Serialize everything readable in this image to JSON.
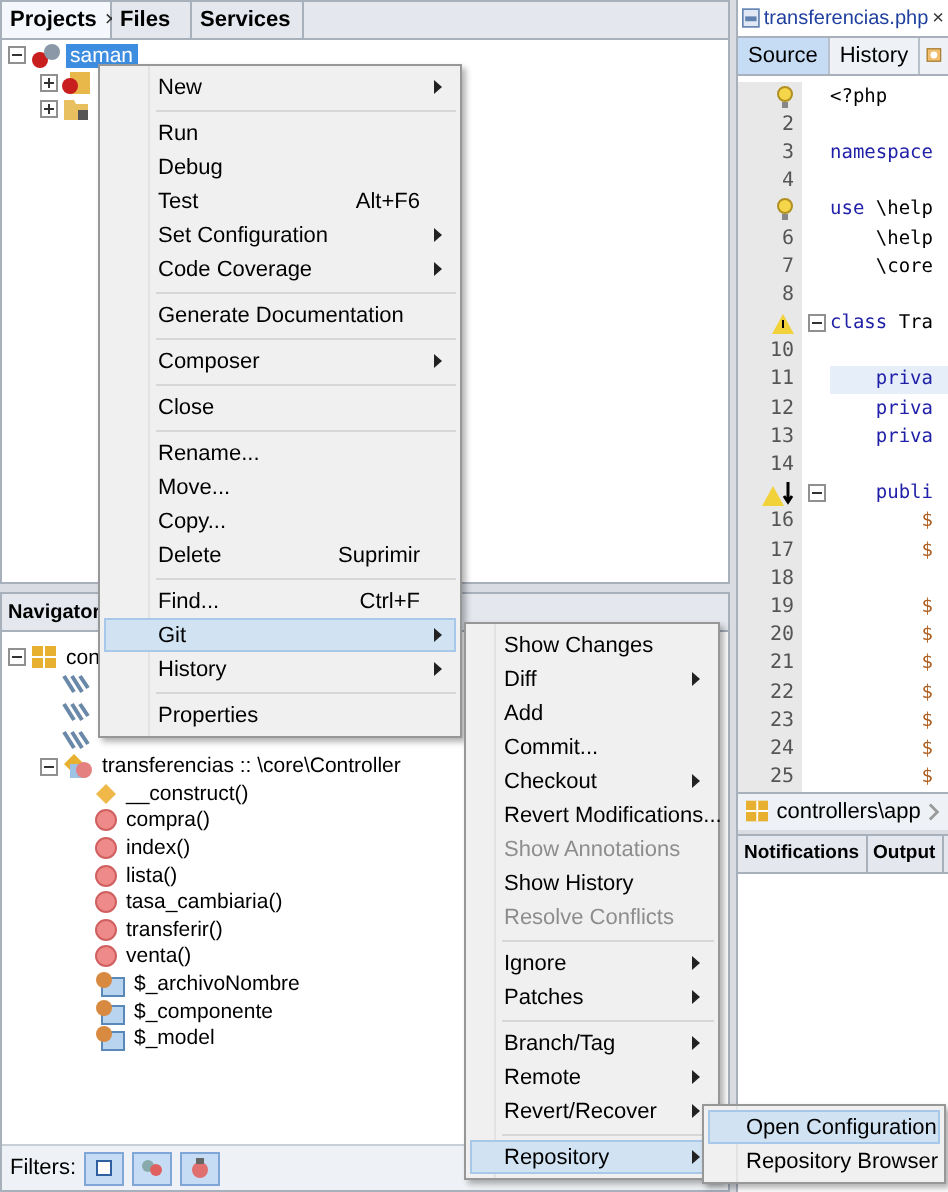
{
  "projects_panel": {
    "tabs": [
      {
        "label": "Projects",
        "selected": true,
        "close": "×"
      },
      {
        "label": "Files",
        "selected": false
      },
      {
        "label": "Services",
        "selected": false
      }
    ],
    "tree": [
      {
        "label": "saman",
        "selected": true,
        "expanded": true,
        "children": [
          {
            "expanded": false,
            "kind": "source"
          },
          {
            "expanded": false,
            "kind": "folder"
          }
        ]
      }
    ]
  },
  "navigator": {
    "title": "Navigator",
    "tree": [
      {
        "label": "con",
        "kind": "namespace",
        "expanded": true,
        "children": [
          {
            "kind": "use"
          },
          {
            "kind": "use"
          },
          {
            "kind": "use"
          },
          {
            "label": "transferencias :: \\core\\Controller",
            "kind": "class",
            "expanded": true,
            "children": [
              {
                "label": "__construct()",
                "kind": "constructor"
              },
              {
                "label": "compra()",
                "kind": "method"
              },
              {
                "label": "index()",
                "kind": "method"
              },
              {
                "label": "lista()",
                "kind": "method"
              },
              {
                "label": "tasa_cambiaria()",
                "kind": "method"
              },
              {
                "label": "transferir()",
                "kind": "method"
              },
              {
                "label": "venta()",
                "kind": "method"
              },
              {
                "label": "$_archivoNombre",
                "kind": "property"
              },
              {
                "label": "$_componente",
                "kind": "property"
              },
              {
                "label": "$_model",
                "kind": "property"
              }
            ]
          }
        ]
      }
    ],
    "filters": {
      "label": "Filters:",
      "buttons": [
        {
          "selected": true
        },
        {
          "selected": true
        },
        {
          "selected": true
        }
      ]
    }
  },
  "editor": {
    "tab": "transferencias.php",
    "tab_close": "×",
    "view_tabs": [
      {
        "label": "Source",
        "selected": true
      },
      {
        "label": "History",
        "selected": false
      }
    ],
    "lines": [
      {
        "kind": "bulb",
        "code": [
          {
            "text": "<?php",
            "kind": "plain"
          }
        ]
      },
      {
        "number": "2"
      },
      {
        "number": "3",
        "code": [
          {
            "text": "namespace",
            "kind": "keyword"
          }
        ]
      },
      {
        "number": "4"
      },
      {
        "kind": "bulb",
        "code": [
          {
            "text": "use",
            "kind": "keyword"
          },
          {
            "text": " \\help",
            "kind": "plain"
          }
        ]
      },
      {
        "number": "6",
        "code": [
          {
            "text": "    \\help",
            "kind": "plain"
          }
        ]
      },
      {
        "number": "7",
        "code": [
          {
            "text": "    \\core",
            "kind": "plain"
          }
        ]
      },
      {
        "number": "8"
      },
      {
        "kind": "warning",
        "fold": true,
        "code": [
          {
            "text": "class",
            "kind": "keyword"
          },
          {
            "text": " Tra",
            "kind": "plain"
          }
        ]
      },
      {
        "number": "10"
      },
      {
        "number": "11",
        "highlighted": true,
        "code": [
          {
            "text": "    priva",
            "kind": "keyword"
          }
        ]
      },
      {
        "number": "12",
        "code": [
          {
            "text": "    priva",
            "kind": "keyword"
          }
        ]
      },
      {
        "number": "13",
        "code": [
          {
            "text": "    priva",
            "kind": "keyword"
          }
        ]
      },
      {
        "number": "14"
      },
      {
        "kind": "warning-arrow",
        "fold": true,
        "code": [
          {
            "text": "    publi",
            "kind": "keyword"
          }
        ]
      },
      {
        "number": "16",
        "code": [
          {
            "text": "        $",
            "kind": "variable"
          }
        ]
      },
      {
        "number": "17",
        "code": [
          {
            "text": "        $",
            "kind": "variable"
          }
        ]
      },
      {
        "number": "18"
      },
      {
        "number": "19",
        "code": [
          {
            "text": "        $",
            "kind": "variable"
          }
        ]
      },
      {
        "number": "20",
        "code": [
          {
            "text": "        $",
            "kind": "variable"
          }
        ]
      },
      {
        "number": "21",
        "code": [
          {
            "text": "        $",
            "kind": "variable"
          }
        ]
      },
      {
        "number": "22",
        "code": [
          {
            "text": "        $",
            "kind": "variable"
          }
        ]
      },
      {
        "number": "23",
        "code": [
          {
            "text": "        $",
            "kind": "variable"
          }
        ]
      },
      {
        "number": "24",
        "code": [
          {
            "text": "        $",
            "kind": "variable"
          }
        ]
      },
      {
        "number": "25",
        "code": [
          {
            "text": "        $",
            "kind": "variable"
          }
        ]
      }
    ],
    "breadcrumb": "controllers\\app"
  },
  "bottom_tabs": [
    "Notifications",
    "Output"
  ],
  "context_menu": [
    {
      "kind": "item",
      "label": "New",
      "submenu": true
    },
    {
      "kind": "separator"
    },
    {
      "kind": "item",
      "label": "Run"
    },
    {
      "kind": "item",
      "label": "Debug"
    },
    {
      "kind": "item",
      "label": "Test",
      "shortcut": "Alt+F6"
    },
    {
      "kind": "item",
      "label": "Set Configuration",
      "submenu": true
    },
    {
      "kind": "item",
      "label": "Code Coverage",
      "submenu": true
    },
    {
      "kind": "separator"
    },
    {
      "kind": "item",
      "label": "Generate Documentation"
    },
    {
      "kind": "separator"
    },
    {
      "kind": "item",
      "label": "Composer",
      "submenu": true
    },
    {
      "kind": "separator"
    },
    {
      "kind": "item",
      "label": "Close"
    },
    {
      "kind": "separator"
    },
    {
      "kind": "item",
      "label": "Rename..."
    },
    {
      "kind": "item",
      "label": "Move..."
    },
    {
      "kind": "item",
      "label": "Copy..."
    },
    {
      "kind": "item",
      "label": "Delete",
      "shortcut": "Suprimir"
    },
    {
      "kind": "separator"
    },
    {
      "kind": "item",
      "label": "Find...",
      "shortcut": "Ctrl+F"
    },
    {
      "kind": "item",
      "label": "Git",
      "submenu": true,
      "highlighted": true
    },
    {
      "kind": "item",
      "label": "History",
      "submenu": true
    },
    {
      "kind": "separator"
    },
    {
      "kind": "item",
      "label": "Properties"
    }
  ],
  "git_menu": [
    {
      "kind": "item",
      "label": "Show Changes"
    },
    {
      "kind": "item",
      "label": "Diff",
      "submenu": true
    },
    {
      "kind": "item",
      "label": "Add"
    },
    {
      "kind": "item",
      "label": "Commit..."
    },
    {
      "kind": "item",
      "label": "Checkout",
      "submenu": true
    },
    {
      "kind": "item",
      "label": "Revert Modifications..."
    },
    {
      "kind": "item",
      "label": "Show Annotations",
      "disabled": true
    },
    {
      "kind": "item",
      "label": "Show History"
    },
    {
      "kind": "item",
      "label": "Resolve Conflicts",
      "disabled": true
    },
    {
      "kind": "separator"
    },
    {
      "kind": "item",
      "label": "Ignore",
      "submenu": true
    },
    {
      "kind": "item",
      "label": "Patches",
      "submenu": true
    },
    {
      "kind": "separator"
    },
    {
      "kind": "item",
      "label": "Branch/Tag",
      "submenu": true
    },
    {
      "kind": "item",
      "label": "Remote",
      "submenu": true
    },
    {
      "kind": "item",
      "label": "Revert/Recover",
      "submenu": true
    },
    {
      "kind": "separator"
    },
    {
      "kind": "item",
      "label": "Repository",
      "submenu": true,
      "highlighted": true
    }
  ],
  "repository_menu": [
    {
      "kind": "item",
      "label": "Open Configuration",
      "highlighted": true
    },
    {
      "kind": "item",
      "label": "Repository Browser"
    }
  ]
}
